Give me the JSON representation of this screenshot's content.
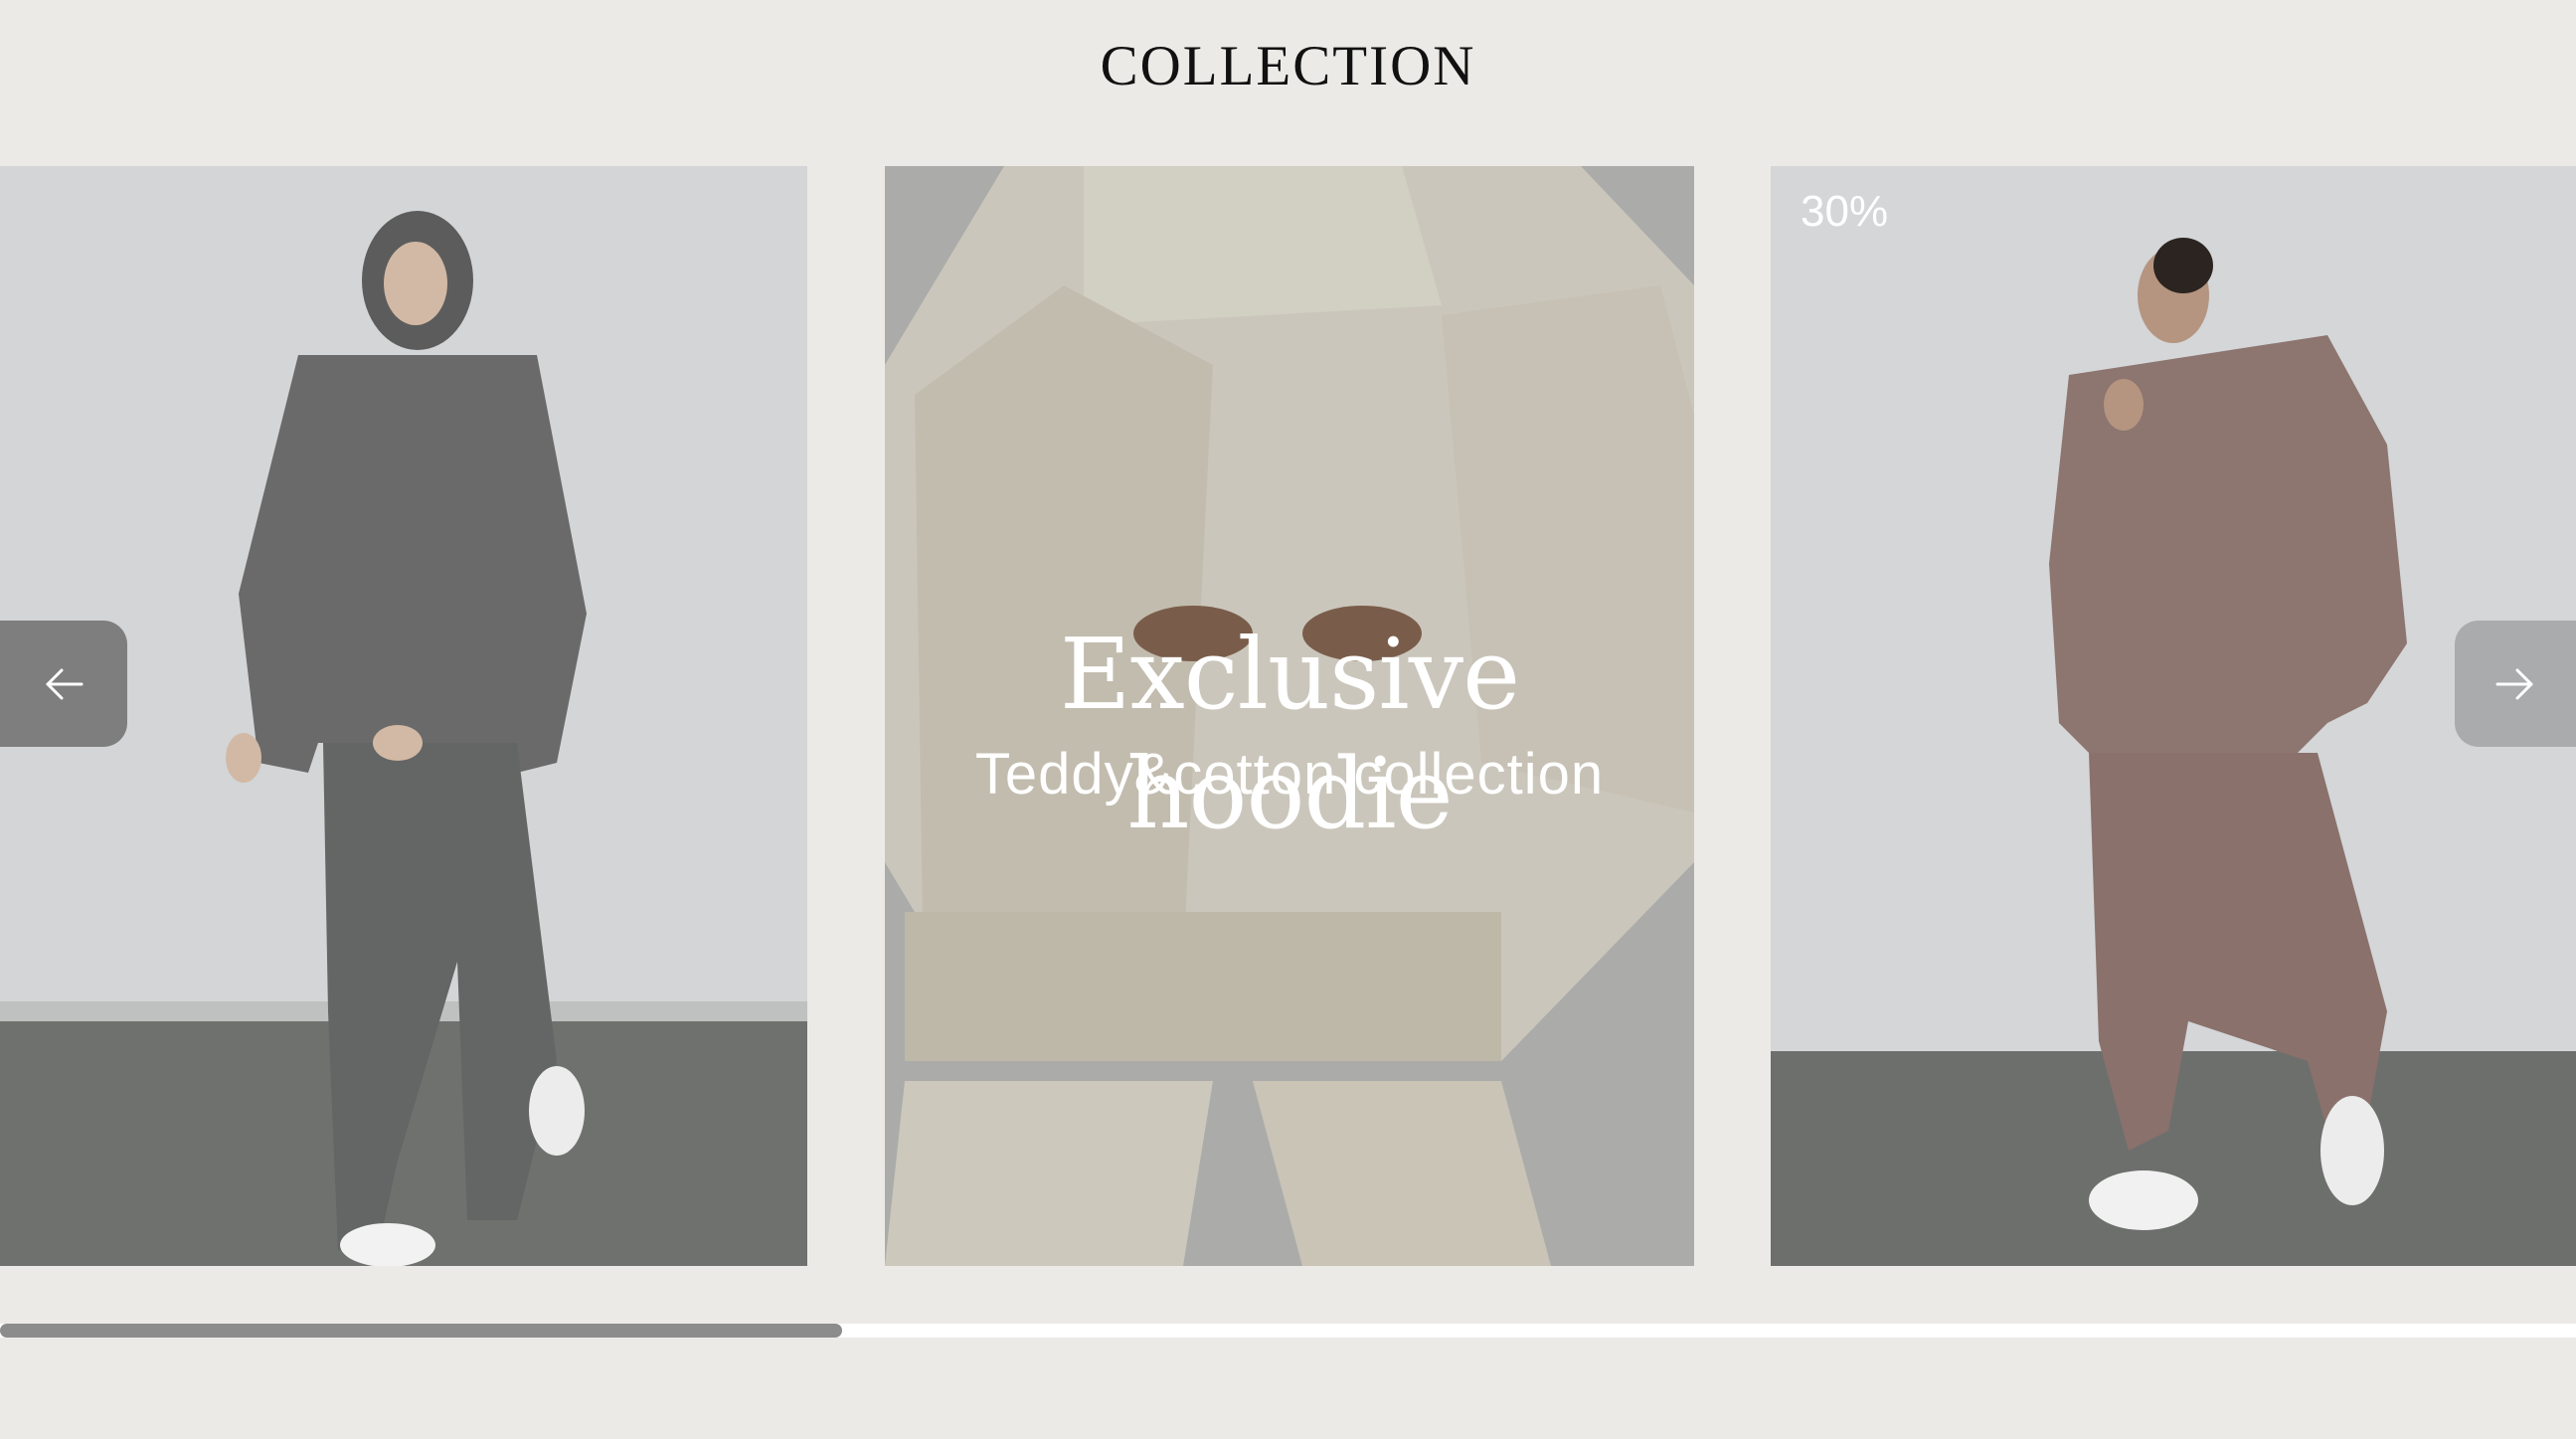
{
  "header": {
    "title": "COLLECTION"
  },
  "carousel": {
    "slides": [
      {
        "name": "grey-teddy-hoodie-set",
        "badge": "",
        "headline": "",
        "subtitle": ""
      },
      {
        "name": "cream-teddy-hoodie-set",
        "badge": "",
        "headline": "Exclusive hoodie",
        "subtitle": "Teddy&cotton collection"
      },
      {
        "name": "mocha-hoodie-set",
        "badge": "30%",
        "headline": "",
        "subtitle": ""
      }
    ],
    "prev_icon": "arrow-left-icon",
    "next_icon": "arrow-right-icon",
    "scroll_progress": 0.327
  },
  "colors": {
    "page_background": "#ebeae6",
    "title_text": "#111111",
    "overlay_text": "#ffffff",
    "scrollbar_track": "#ffffff",
    "scrollbar_thumb": "#8c8c8c",
    "nav_button": "#6e6e6e"
  }
}
